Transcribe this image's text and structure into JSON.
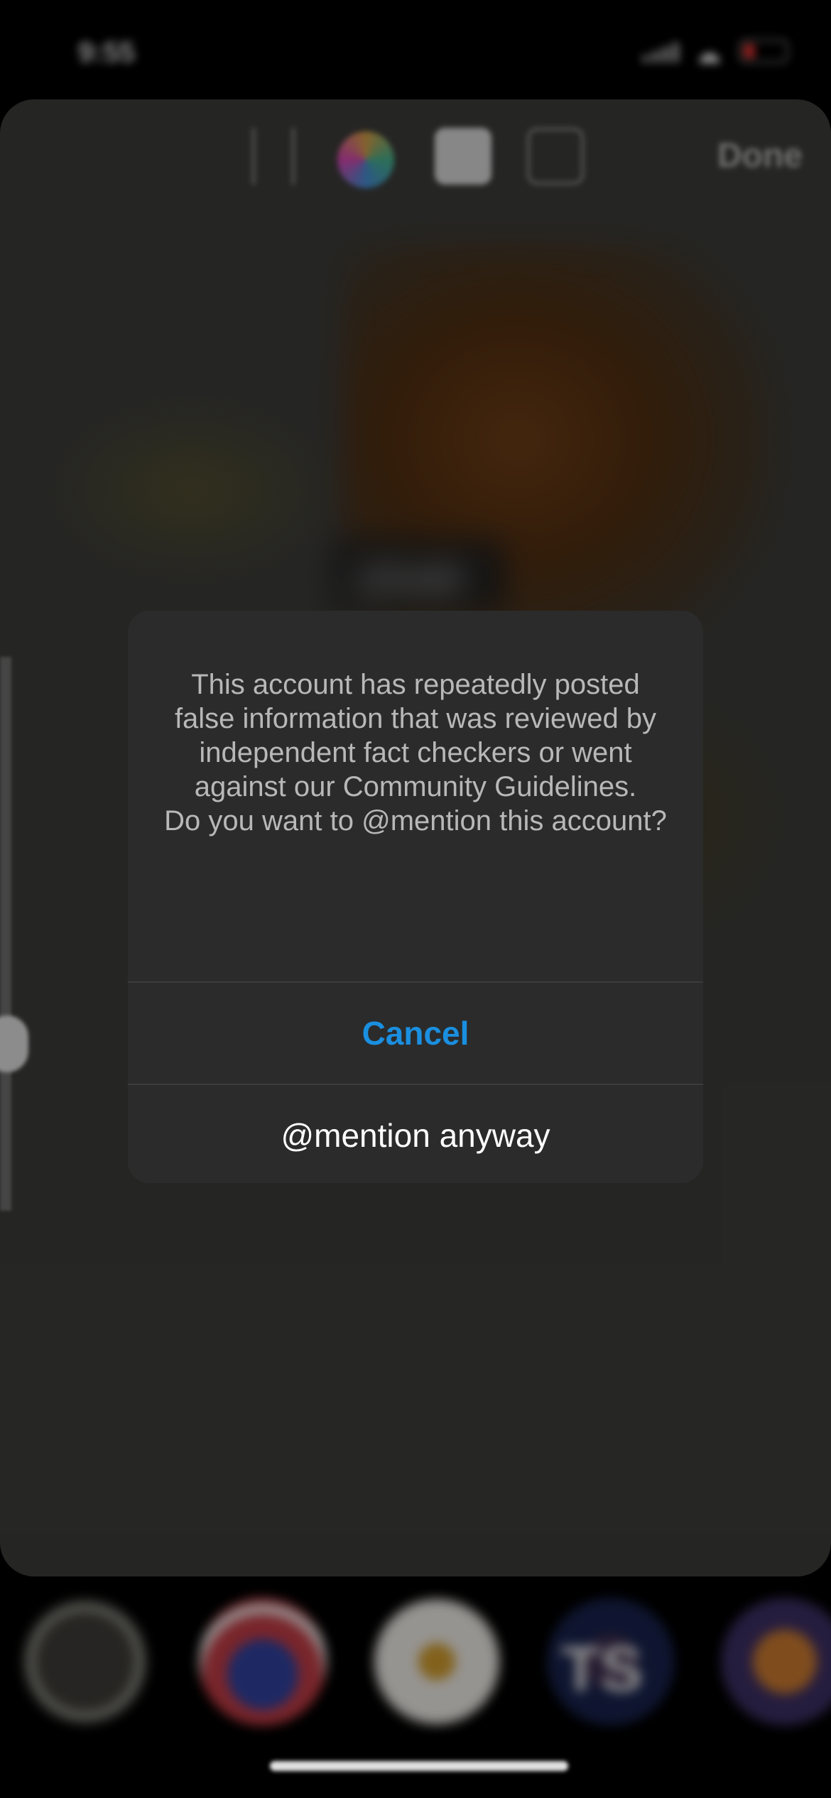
{
  "status_bar": {
    "time": "9:55"
  },
  "story_editor": {
    "done_label": "Done",
    "tag_text": "@tubi",
    "toolbar_icons": [
      "text-icon",
      "color-wheel-icon",
      "sticker-icon",
      "draw-icon"
    ]
  },
  "alert": {
    "message": "This account has repeatedly posted false information that was reviewed by independent fact checkers or went against our Community Guidelines.\nDo you want to @mention this account?",
    "cancel_label": "Cancel",
    "mention_label": "@mention anyway",
    "accent_color": "#1a8fe0"
  },
  "tray": {
    "avatar_count": 5,
    "avatar_4_initials": "TS"
  }
}
